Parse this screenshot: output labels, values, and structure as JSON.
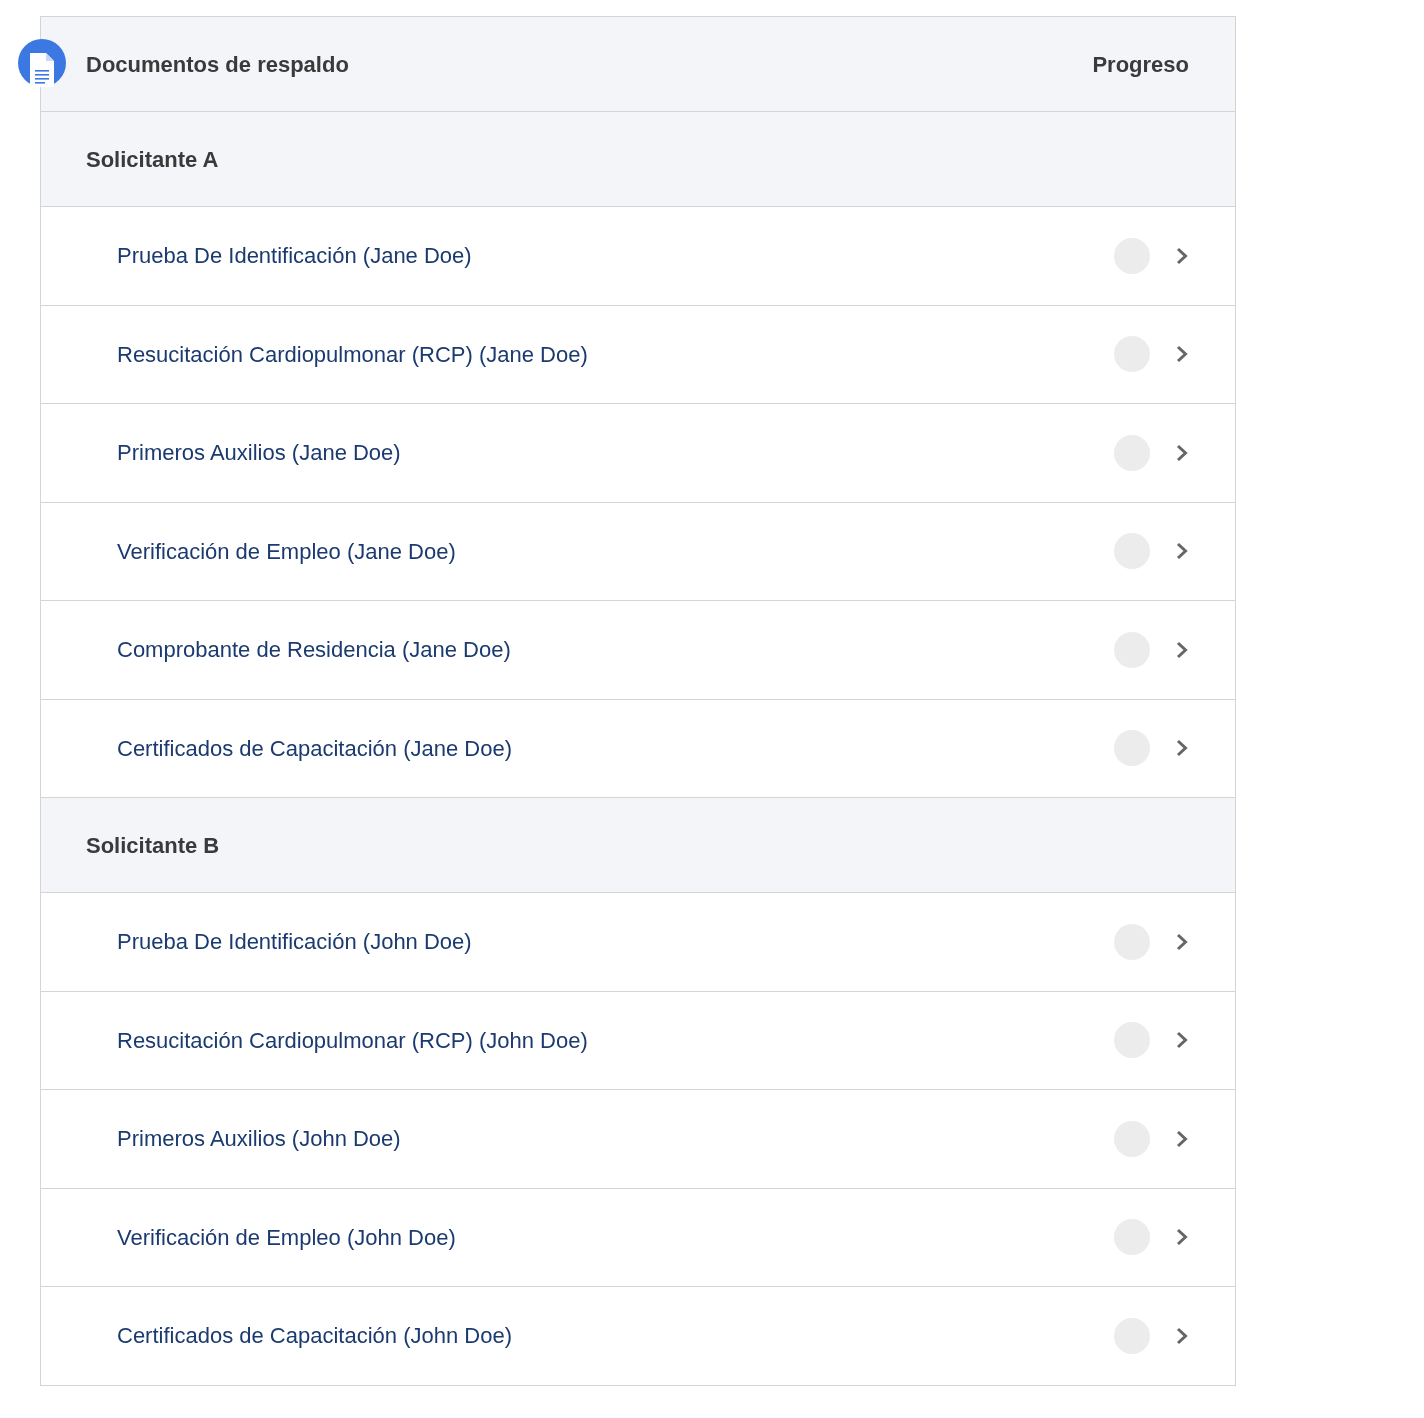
{
  "header": {
    "title": "Documentos de respaldo",
    "progress_label": "Progreso"
  },
  "groups": [
    {
      "title": "Solicitante A",
      "items": [
        {
          "label": "Prueba De Identificación (Jane Doe)"
        },
        {
          "label": "Resucitación Cardiopulmonar (RCP) (Jane Doe)"
        },
        {
          "label": "Primeros Auxilios (Jane Doe)"
        },
        {
          "label": "Verificación de Empleo (Jane Doe)"
        },
        {
          "label": "Comprobante de Residencia (Jane Doe)"
        },
        {
          "label": "Certificados de Capacitación (Jane Doe)"
        }
      ]
    },
    {
      "title": "Solicitante B",
      "items": [
        {
          "label": "Prueba De Identificación (John Doe)"
        },
        {
          "label": "Resucitación Cardiopulmonar (RCP) (John Doe)"
        },
        {
          "label": "Primeros Auxilios (John Doe)"
        },
        {
          "label": "Verificación de Empleo (John Doe)"
        },
        {
          "label": "Certificados de Capacitación (John Doe)"
        }
      ]
    }
  ]
}
